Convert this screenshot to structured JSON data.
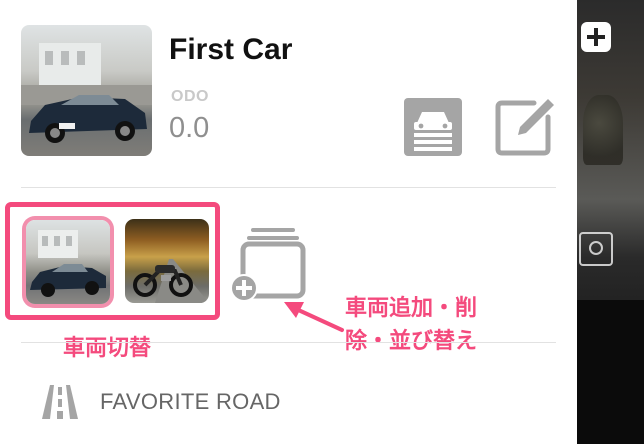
{
  "car": {
    "name": "First Car",
    "odo_label": "ODO",
    "odo_value": "0.0"
  },
  "annotations": {
    "switch_vehicle": "車両切替",
    "manage_vehicles_line1": "車両追加・削",
    "manage_vehicles_line2": "除・並び替え"
  },
  "menu": {
    "favorite_road": "FAVORITE ROAD"
  },
  "icons": {
    "garage": "garage-icon",
    "edit": "edit-icon",
    "add_vehicle": "add-vehicle-icon",
    "road": "road-icon"
  },
  "colors": {
    "accent_pink": "#f44a7d",
    "icon_gray": "#a5a5a5"
  }
}
